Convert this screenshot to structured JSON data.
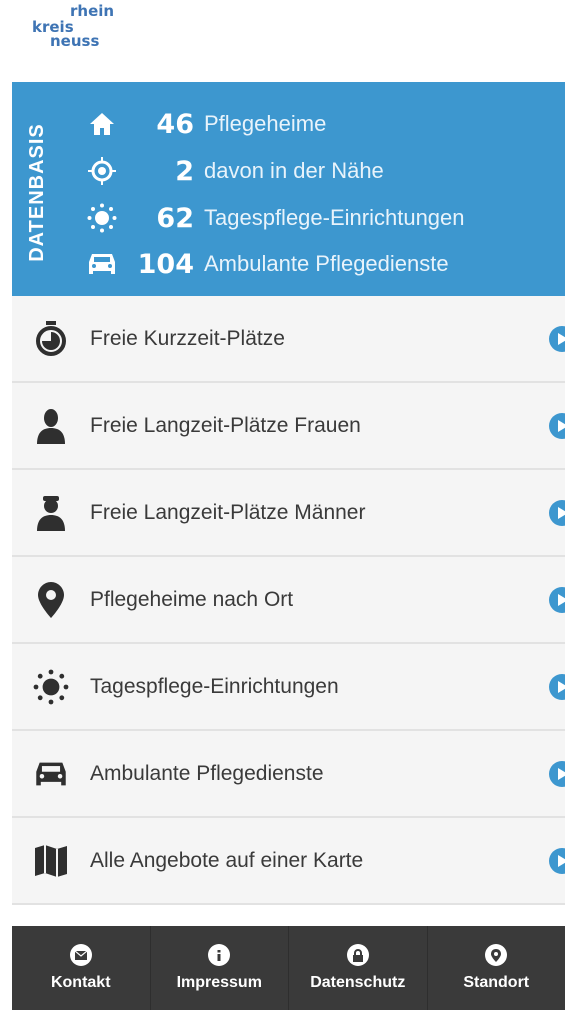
{
  "logo": {
    "line1": "rhein",
    "line2": "kreis",
    "line3": "neuss"
  },
  "stats": {
    "section_label": "DATENBASIS",
    "rows": [
      {
        "icon": "home-icon",
        "value": "46",
        "label": "Pflegeheime"
      },
      {
        "icon": "target-icon",
        "value": "2",
        "label": "davon in der Nähe"
      },
      {
        "icon": "sun-icon",
        "value": "62",
        "label": "Tagespflege-Einrichtungen"
      },
      {
        "icon": "car-icon",
        "value": "104",
        "label": "Ambulante Pflegedienste"
      }
    ]
  },
  "menu": {
    "items": [
      {
        "icon": "stopwatch-icon",
        "label": "Freie Kurzzeit-Plätze"
      },
      {
        "icon": "woman-icon",
        "label": "Freie Langzeit-Plätze Frauen"
      },
      {
        "icon": "man-icon",
        "label": "Freie Langzeit-Plätze Männer"
      },
      {
        "icon": "map-pin-icon",
        "label": "Pflegeheime nach Ort"
      },
      {
        "icon": "sun-icon",
        "label": "Tagespflege-Einrichtungen"
      },
      {
        "icon": "car-icon",
        "label": "Ambulante Pflegedienste"
      },
      {
        "icon": "map-icon",
        "label": "Alle Angebote auf einer Karte"
      }
    ]
  },
  "bottomnav": {
    "items": [
      {
        "icon": "envelope-icon",
        "label": "Kontakt"
      },
      {
        "icon": "info-icon",
        "label": "Impressum"
      },
      {
        "icon": "lock-icon",
        "label": "Datenschutz"
      },
      {
        "icon": "location-icon",
        "label": "Standort"
      }
    ]
  },
  "colors": {
    "accent": "#3d97cf",
    "nav_bg": "#3a3a3a",
    "list_bg": "#f5f5f5",
    "logo": "#3e74b4"
  }
}
